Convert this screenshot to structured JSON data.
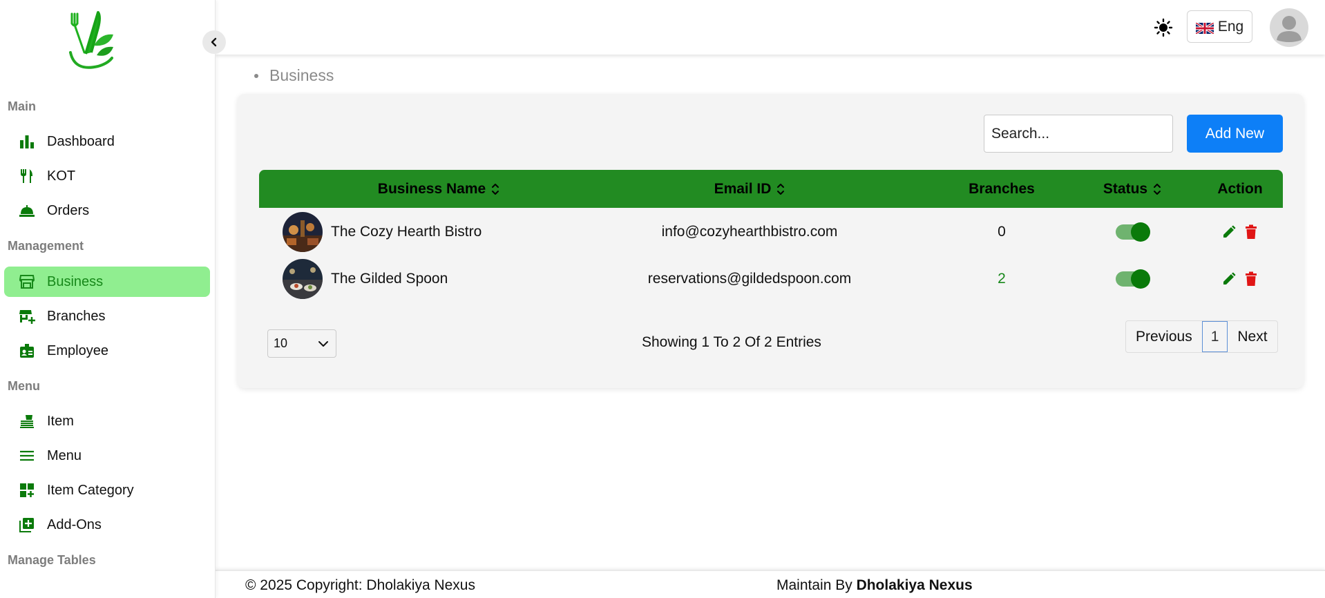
{
  "sidebar": {
    "sections": {
      "main": "Main",
      "management": "Management",
      "menu": "Menu",
      "manage_tables": "Manage Tables"
    },
    "items": [
      {
        "label": "Dashboard",
        "icon": "bar-chart-icon"
      },
      {
        "label": "KOT",
        "icon": "fork-knife-icon"
      },
      {
        "label": "Orders",
        "icon": "cloche-icon"
      },
      {
        "label": "Business",
        "icon": "storefront-icon",
        "active": true
      },
      {
        "label": "Branches",
        "icon": "store-add-icon"
      },
      {
        "label": "Employee",
        "icon": "id-badge-icon"
      },
      {
        "label": "Item",
        "icon": "food-serving-icon"
      },
      {
        "label": "Menu",
        "icon": "hamburger-lines-icon"
      },
      {
        "label": "Item Category",
        "icon": "category-grid-icon"
      },
      {
        "label": "Add-Ons",
        "icon": "add-box-icon"
      }
    ]
  },
  "header": {
    "language": "Eng",
    "theme_icon": "sun-icon",
    "avatar_icon": "user-avatar-icon"
  },
  "breadcrumb": {
    "current": "Business"
  },
  "toolbar": {
    "search_placeholder": "Search...",
    "add_label": "Add New"
  },
  "table": {
    "columns": [
      "Business Name",
      "Email ID",
      "Branches",
      "Status",
      "Action"
    ],
    "rows": [
      {
        "name": "The Cozy Hearth Bistro",
        "email": "info@cozyhearthbistro.com",
        "branches": "0",
        "status": true
      },
      {
        "name": "The Gilded Spoon",
        "email": "reservations@gildedspoon.com",
        "branches": "2",
        "status": true
      }
    ]
  },
  "pagination": {
    "page_size": "10",
    "summary": "Showing 1 To 2 Of 2 Entries",
    "previous": "Previous",
    "current": "1",
    "next": "Next"
  },
  "footer": {
    "copyright": "© 2025 Copyright: Dholakiya Nexus",
    "maintain_prefix": "Maintain By",
    "maintain_name": "Dholakiya Nexus"
  },
  "colors": {
    "brand_green": "#228b22",
    "active_bg": "#90ee90",
    "primary_blue": "#0d7ff7",
    "delete_red": "#e01515"
  }
}
